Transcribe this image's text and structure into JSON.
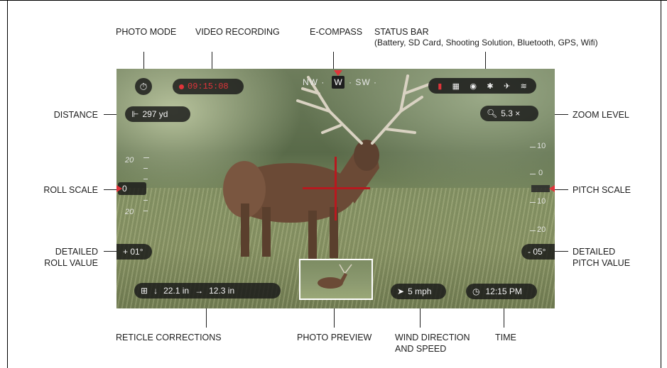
{
  "callouts": {
    "photo_mode": "PHOTO MODE",
    "video_recording": "VIDEO RECORDING",
    "e_compass": "E-COMPASS",
    "status_bar": "STATUS BAR",
    "status_bar_detail": "(Battery, SD Card, Shooting Solution, Bluetooth, GPS, Wifi)",
    "distance": "DISTANCE",
    "zoom_level": "ZOOM LEVEL",
    "roll_scale": "ROLL SCALE",
    "pitch_scale": "PITCH SCALE",
    "detailed_roll_line1": "DETAILED",
    "detailed_roll_line2": "ROLL VALUE",
    "detailed_pitch_line1": "DETAILED",
    "detailed_pitch_line2": "PITCH VALUE",
    "reticle_corrections": "RETICLE CORRECTIONS",
    "photo_preview": "PHOTO PREVIEW",
    "wind_line1": "WIND DIRECTION",
    "wind_line2": "AND SPEED",
    "time": "TIME"
  },
  "hud": {
    "recording_time": "09:15:08",
    "compass_left": "NW ·",
    "compass_center": "W",
    "compass_right": "· SW ·",
    "distance_value": "297 yd",
    "zoom_value": "5.3 ×",
    "roll_value": "0",
    "roll_detail": "+ 01°",
    "pitch_detail": "- 05°",
    "correction_down": "22.1 in",
    "correction_right": "12.3 in",
    "wind_value": "5 mph",
    "time_value": "12:15 PM",
    "roll_scale_labels": [
      "20",
      "20"
    ],
    "pitch_scale_labels": [
      "10",
      "0",
      "10",
      "20"
    ]
  },
  "colors": {
    "accent_red": "#e0343a",
    "reticle_red": "#b8191f",
    "hud_pill_bg": "#191919"
  },
  "icons": {
    "photo_mode": "timer-icon",
    "rec": "record-dot-icon",
    "distance": "rangefinder-flag-icon",
    "zoom": "magnifier-icon",
    "reticle_correction": "reticle-adjust-icon",
    "wind": "wind-arrow-icon",
    "time": "clock-icon",
    "battery": "battery-icon",
    "sd_card": "sd-card-icon",
    "shooting_solution": "target-icon",
    "bluetooth": "bluetooth-icon",
    "gps": "gps-icon",
    "wifi": "wifi-icon"
  }
}
